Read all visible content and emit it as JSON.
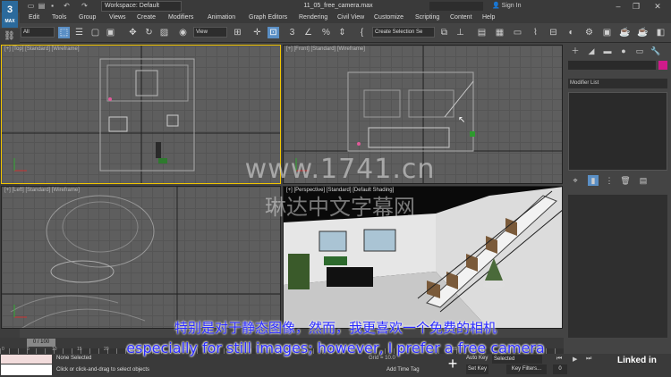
{
  "app": {
    "logo_text": "3",
    "logo_sub": "MAX",
    "workspace": "Workspace: Default",
    "document_title": "11_05_free_camera.max",
    "sign_in": "Sign In"
  },
  "menu": [
    "Edit",
    "Tools",
    "Group",
    "Views",
    "Create",
    "Modifiers",
    "Animation",
    "Graph Editors",
    "Rendering",
    "Civil View",
    "Customize",
    "Scripting",
    "Content",
    "Help"
  ],
  "toolbar": {
    "filter": "All",
    "ref_coord": "View",
    "selection_set": "Create Selection Se"
  },
  "viewports": {
    "top": "[+] [Top] [Standard] [Wireframe]",
    "front": "[+] [Front] [Standard] [Wireframe]",
    "left": "[+] [Left] [Standard] [Wireframe]",
    "perspective": "[+] [Perspective] [Standard] [Default Shading]"
  },
  "command_panel": {
    "modifier_list": "Modifier List"
  },
  "timeline": {
    "slider": "0 / 100",
    "ticks": [
      "0",
      "5",
      "10",
      "15",
      "20",
      "25",
      "30",
      "35",
      "40",
      "45",
      "50",
      "55",
      "60",
      "65",
      "70",
      "75",
      "80",
      "85",
      "90",
      "95",
      "100"
    ]
  },
  "status": {
    "selection": "None Selected",
    "prompt": "Click or click-and-drag to select objects",
    "add_time_tag": "Add Time Tag",
    "grid": "Grid = 10.0",
    "auto_key": "Auto Key",
    "set_key": "Set Key",
    "selected": "Selected",
    "key_filters": "Key Filters...",
    "frame": "0"
  },
  "subtitles": {
    "chinese": "特别是对于静态图像，然而，我更喜欢一个免费的相机",
    "english": "especially for still images; however, I prefer a free camera"
  },
  "watermark": {
    "line1": "www.1741.cn",
    "line2": "琳达中文字幕网"
  },
  "brand": "Linked in"
}
